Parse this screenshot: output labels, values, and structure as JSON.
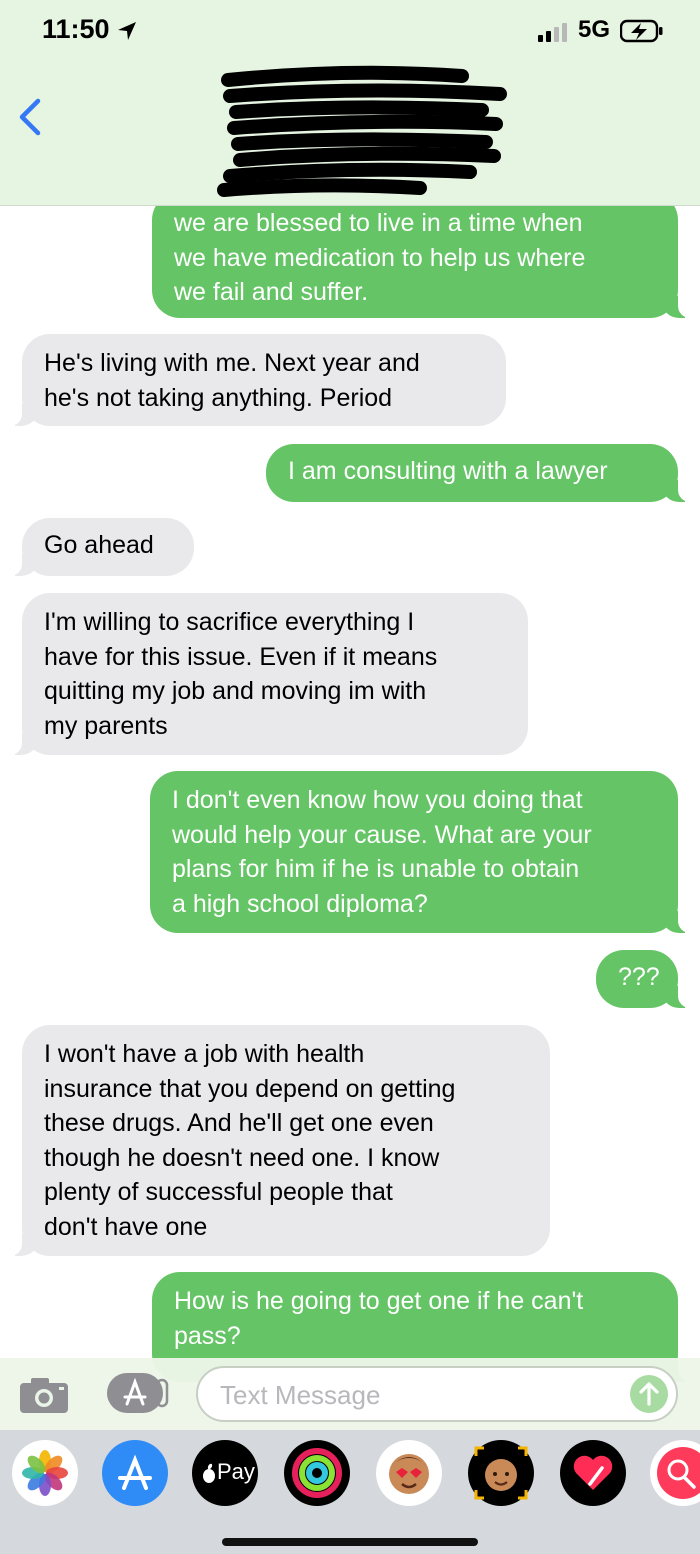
{
  "status_bar": {
    "time": "11:50",
    "network": "5G",
    "location_icon": "location-arrow-icon",
    "signal_icon": "cellular-signal-icon",
    "battery_icon": "battery-charging-icon"
  },
  "header": {
    "back_icon": "chevron-left-icon",
    "contact_name_redacted": true
  },
  "messages": [
    {
      "sender": "me",
      "text": "we are blessed to live in a time when\nwe have medication to help us where\nwe fail and suffer."
    },
    {
      "sender": "them",
      "text": "He's living with me. Next year and\nhe's not taking anything.  Period"
    },
    {
      "sender": "me",
      "text": "I am consulting with a lawyer"
    },
    {
      "sender": "them",
      "text": "Go ahead"
    },
    {
      "sender": "them",
      "text": "I'm willing to sacrifice everything I\nhave for this issue.  Even if it means\nquitting my job and moving im with\nmy parents"
    },
    {
      "sender": "me",
      "text": "I don't even know how you doing that\nwould help your cause. What are your\nplans for him if he is unable to obtain\na high school diploma?"
    },
    {
      "sender": "me",
      "text": "???"
    },
    {
      "sender": "them",
      "text": "I won't have a job with health\ninsurance that you depend on getting\nthese drugs. And he'll get one even\nthough he doesn't need one. I know\nplenty of successful people that\ndon't have one"
    },
    {
      "sender": "me",
      "text": "How is he going to get one if he can't\npass?"
    }
  ],
  "input_bar": {
    "placeholder": "Text Message",
    "camera_icon": "camera-icon",
    "apps_icon": "app-store-icon",
    "send_icon": "send-arrow-icon"
  },
  "app_drawer": {
    "apps": [
      {
        "name": "photos-icon"
      },
      {
        "name": "app-store-icon"
      },
      {
        "name": "apple-pay-icon",
        "label": "Pay"
      },
      {
        "name": "activity-icon"
      },
      {
        "name": "memoji-stickers-icon"
      },
      {
        "name": "memoji-icon"
      },
      {
        "name": "digital-touch-icon"
      },
      {
        "name": "web-search-icon"
      }
    ]
  },
  "colors": {
    "sent_bubble": "#65c466",
    "received_bubble": "#e9e9eb",
    "header_background": "#e6f4e2",
    "accent": "#3478f6"
  }
}
